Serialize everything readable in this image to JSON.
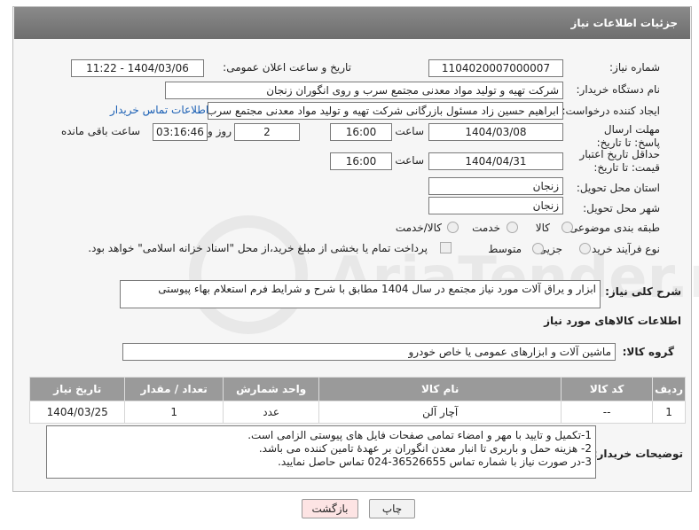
{
  "header": {
    "title": "جزئیات اطلاعات نیاز"
  },
  "fields": {
    "need_number_label": "شماره نیاز:",
    "need_number": "1104020007000007",
    "announce_label": "تاریخ و ساعت اعلان عمومی:",
    "announce_value": "1404/03/06 - 11:22",
    "buyer_label": "نام دستگاه خریدار:",
    "buyer_value": "شرکت تهیه و تولید مواد معدنی مجتمع سرب و روی انگوران   زنجان",
    "creator_label": "ایجاد کننده درخواست:",
    "creator_value": "ابراهیم حسین زاد مسئول بازرگانی شرکت تهیه و تولید مواد معدنی مجتمع سرب",
    "contact_link": "اطلاعات تماس خریدار",
    "deadline_label": "مهلت ارسال پاسخ: تا تاریخ:",
    "deadline_date": "1404/03/08",
    "time_label": "ساعت",
    "deadline_time": "16:00",
    "days_value": "2",
    "days_label": "روز و",
    "remaining_value": "03:16:46",
    "remaining_label": "ساعت باقی مانده",
    "price_label": "حداقل تاریخ اعتبار قیمت: تا تاریخ:",
    "price_date": "1404/04/31",
    "price_time": "16:00",
    "province_label": "استان محل تحویل:",
    "province_value": "زنجان",
    "city_label": "شهر محل تحویل:",
    "city_value": "زنجان",
    "category_label": "طبقه بندی موضوعی:",
    "category_options": [
      "کالا",
      "خدمت",
      "کالا/خدمت"
    ],
    "process_label": "نوع فرآیند خرید :",
    "process_options": [
      "جزیی",
      "متوسط"
    ],
    "payment_note": "پرداخت تمام یا بخشی از مبلغ خرید،از محل \"اسناد خزانه اسلامی\" خواهد بود."
  },
  "description": {
    "label": "شرح کلی نیاز:",
    "value": "ابزار و یراق آلات مورد نیاز مجتمع در سال 1404 مطابق با شرح و شرایط فرم استعلام بهاء پیوستی"
  },
  "goods": {
    "section_title": "اطلاعات کالاهای مورد نیاز",
    "group_label": "گروه کالا:",
    "group_value": "ماشین آلات و ابزارهای عمومی یا خاص خودرو",
    "columns": [
      "ردیف",
      "کد کالا",
      "نام کالا",
      "واحد شمارش",
      "تعداد / مقدار",
      "تاریخ نیاز"
    ],
    "rows": [
      {
        "row": "1",
        "code": "--",
        "name": "آچار آلن",
        "unit": "عدد",
        "qty": "1",
        "date": "1404/03/25"
      }
    ]
  },
  "buyer_notes": {
    "label": "توضیحات خریدار:",
    "lines": [
      "1-تکمیل و تایید با مهر و امضاء تمامی صفحات فایل های پیوستی الزامی است.",
      "2- هزینه حمل و باربری تا انبار معدن انگوران بر عهدهٔ تامین کننده می باشد.",
      "3-در صورت نیاز با شماره تماس 36526655-024 تماس حاصل نمایید."
    ]
  },
  "buttons": {
    "print": "چاپ",
    "back": "بازگشت"
  },
  "watermark": {
    "text": "AriaTender.neT"
  }
}
